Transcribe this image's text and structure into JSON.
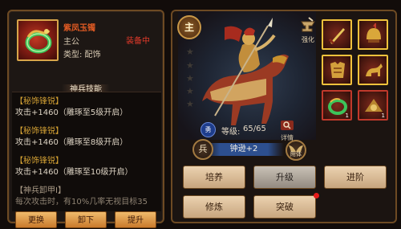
{
  "item": {
    "name": "紫凤玉镯",
    "status": "装备中",
    "owner": "主公",
    "type": "类型: 配饰"
  },
  "skills_header": "神兵技能",
  "skills": [
    {
      "name": "【秘饰锋锐】",
      "desc": "攻击+1460（雕琢至5级开启）"
    },
    {
      "name": "【秘饰锋锐】",
      "desc": "攻击+1460（雕琢至8级开启）"
    },
    {
      "name": "【秘饰锋锐】",
      "desc": "攻击+1460（雕琢至10级开启）"
    }
  ],
  "passive": {
    "name": "【神兵卸甲I】",
    "desc": "每次攻击时，有10%几率无视目标35"
  },
  "left_buttons": {
    "replace": "更换",
    "unequip": "卸下",
    "upgrade": "提升"
  },
  "hero": {
    "main_badge": "主",
    "stars_total": 5,
    "strengthen": "强化",
    "brave_badge": "勇",
    "level_label": "等级:",
    "level_value": "65/65",
    "detail": "详情",
    "soldier_badge": "兵",
    "name": "钟逊+2",
    "attach": "附体"
  },
  "equipment_slots": [
    {
      "icon": "sword-icon",
      "count": ""
    },
    {
      "icon": "helmet-icon",
      "count": ""
    },
    {
      "icon": "armor-icon",
      "count": ""
    },
    {
      "icon": "horse-icon",
      "count": ""
    },
    {
      "icon": "bracelet-icon",
      "count": "1"
    },
    {
      "icon": "treasure-icon",
      "count": "1"
    }
  ],
  "actions": {
    "cultivate": "培养",
    "level_up": "升级",
    "advance": "进阶",
    "refine": "修炼",
    "breakthrough": "突破"
  },
  "colors": {
    "panel_border": "#6d4a23",
    "gold": "#f0c23c",
    "skill_title": "#d5a234",
    "equipped_red": "#e43a2a"
  }
}
